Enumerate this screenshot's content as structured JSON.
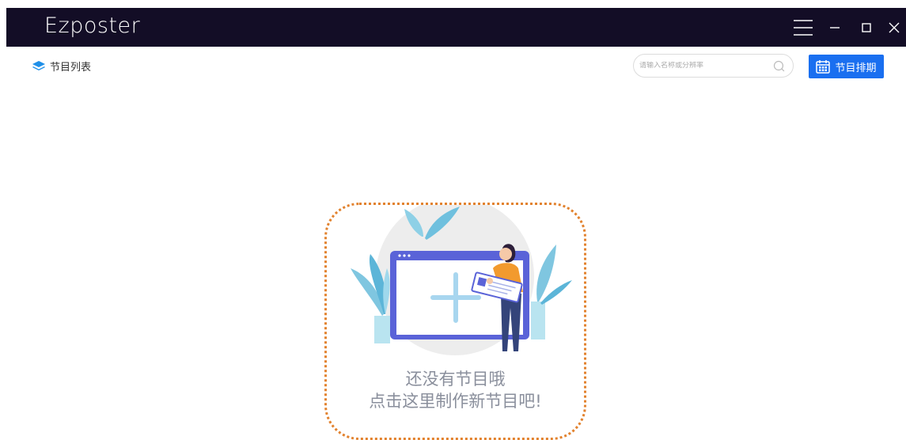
{
  "app": {
    "title": "Ezposter"
  },
  "window_controls": [
    "menu-icon",
    "minimize-icon",
    "maximize-icon",
    "close-icon"
  ],
  "toolbar": {
    "list_title": "节目列表",
    "search_placeholder": "请输入名称或分辨率",
    "schedule_label": "节目排期"
  },
  "empty_state": {
    "line1": "还没有节目哦",
    "line2": "点击这里制作新节目吧!"
  },
  "colors": {
    "titlebar": "#130d26",
    "accent": "#1a6ff0",
    "dotted_border": "#e2822e"
  }
}
